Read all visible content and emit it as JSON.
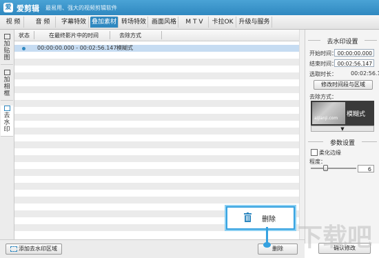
{
  "titlebar": {
    "app_name": "爱剪辑",
    "slogan": "最易用、强大的视频剪辑软件",
    "logo_glyph": "爱"
  },
  "tabs": [
    {
      "label": "视  频"
    },
    {
      "label": "音  频"
    },
    {
      "label": "字幕特效"
    },
    {
      "label": "叠加素材"
    },
    {
      "label": "转场特效"
    },
    {
      "label": "画面风格"
    },
    {
      "label": "M T V"
    },
    {
      "label": "卡拉OK"
    },
    {
      "label": "升级与服务"
    }
  ],
  "active_tab": "叠加素材",
  "sidebar": {
    "items": [
      {
        "label": "加贴图"
      },
      {
        "label": "加相框"
      },
      {
        "label": "去水印"
      }
    ],
    "active": "去水印"
  },
  "table": {
    "headers": [
      "状态",
      "在最终影片中的时间",
      "去除方式"
    ],
    "rows": [
      {
        "time": "00:00:00.000 - 00:02:56.147",
        "method": "模糊式",
        "selected": true
      }
    ]
  },
  "panel": {
    "section_title": "去水印设置",
    "start_label": "开始时间：",
    "start_value": "00:00:00.000",
    "end_label": "结束时间：",
    "end_value": "00:02:56.147",
    "duration_label": "选取时长：",
    "duration_value": "00:02:56.147",
    "modify_button": "修改时间段与区域",
    "method_label": "去除方式：",
    "method_thumb_text": "aijianji.com",
    "method_name": "模糊式",
    "method_arrow": "▼",
    "params_title": "参数设置",
    "feather_label": "柔化边缘",
    "degree_label": "程度：",
    "degree_value": 6,
    "degree_max": 20
  },
  "bottom": {
    "add_button": "添加去水印区域",
    "delete_button": "删除",
    "confirm_button": "确认修改"
  },
  "callout": {
    "label": "删除"
  },
  "watermark": {
    "text": "下载吧"
  },
  "colors": {
    "accent": "#2f88c0",
    "callout_border": "#36a2e0",
    "selected_row": "#c6dcf2"
  }
}
